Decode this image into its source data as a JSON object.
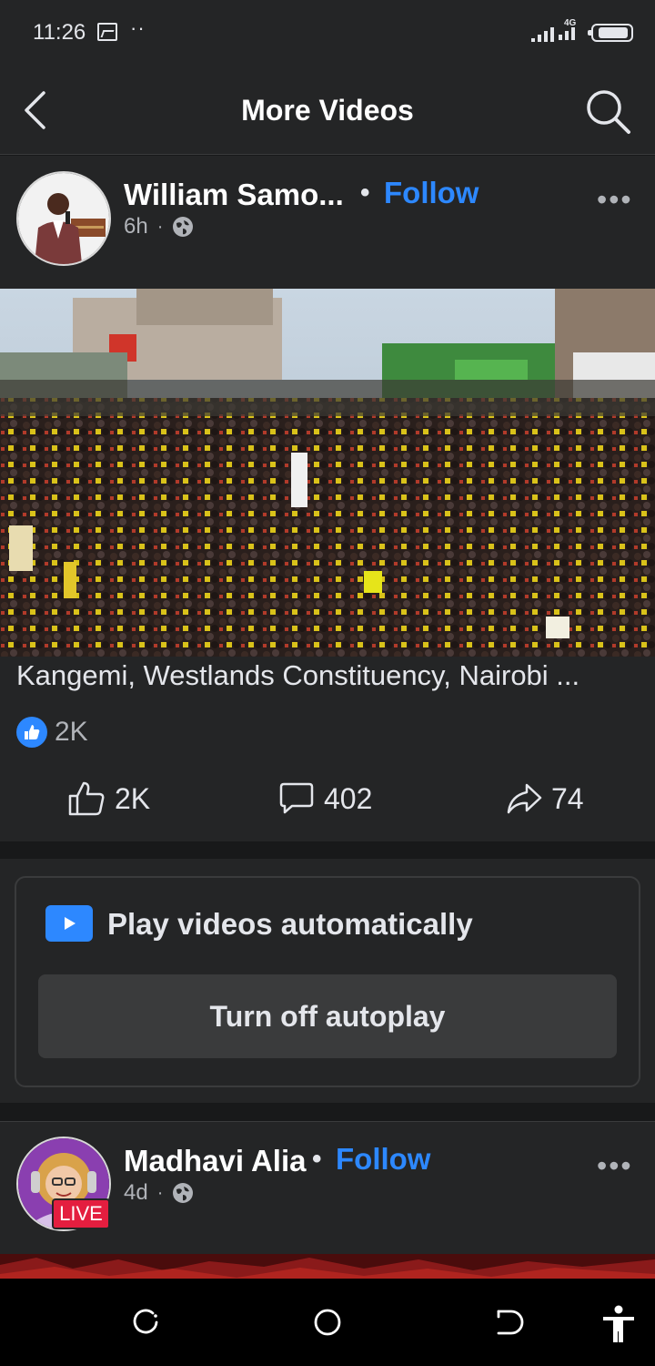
{
  "status_bar": {
    "time": "11:26",
    "dots": "··",
    "network": "4G",
    "icons": [
      "image-icon",
      "signal-icon",
      "battery-icon"
    ]
  },
  "header": {
    "title": "More Videos",
    "back_icon": "chevron-left-icon",
    "search_icon": "search-icon"
  },
  "post1": {
    "author": "William Samo...",
    "follow_sep": "•",
    "follow_label": "Follow",
    "time": "6h",
    "meta_sep": "·",
    "privacy_icon": "globe-icon",
    "more_label": "•••",
    "caption": "Kangemi, Westlands Constituency, Nairobi ...",
    "reaction_count": "2K",
    "actions": {
      "like_count": "2K",
      "comment_count": "402",
      "share_count": "74"
    }
  },
  "autoplay": {
    "title": "Play videos automatically",
    "button_label": "Turn off autoplay"
  },
  "post2": {
    "author": "Madhavi Alia",
    "follow_sep": "•",
    "follow_label": "Follow",
    "time": "4d",
    "meta_sep": "·",
    "live_badge": "LIVE",
    "more_label": "•••"
  },
  "colors": {
    "accent": "#2d88ff",
    "background": "#18191a",
    "card": "#242526",
    "live": "#e41e3f"
  }
}
